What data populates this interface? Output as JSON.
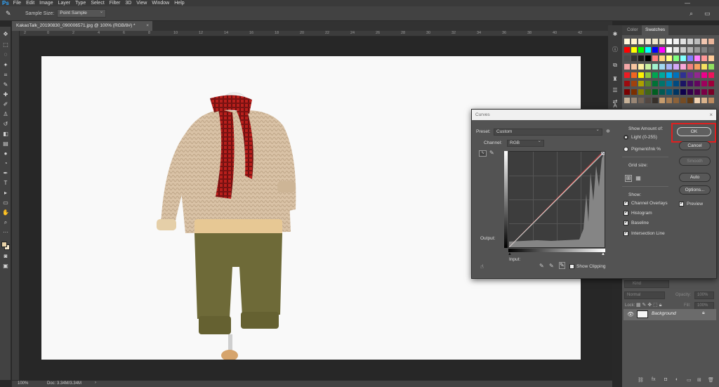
{
  "app": {
    "logo": "Ps"
  },
  "menu": [
    "File",
    "Edit",
    "Image",
    "Layer",
    "Type",
    "Select",
    "Filter",
    "3D",
    "View",
    "Window",
    "Help"
  ],
  "options_bar": {
    "sample_size_label": "Sample Size:",
    "sample_size_value": "Point Sample"
  },
  "document": {
    "tab_title": "KakaoTalk_20190830_090006571.jpg @ 100% (RGB/8#) *",
    "close_glyph": "×"
  },
  "ruler_top_numbers": [
    "2",
    "0",
    "2",
    "4",
    "6",
    "8",
    "10",
    "12",
    "14",
    "16",
    "18",
    "20",
    "22",
    "24",
    "26",
    "28",
    "30",
    "32",
    "34",
    "36",
    "38",
    "40",
    "42"
  ],
  "status": {
    "zoom": "100%",
    "doc": "Doc: 3.34M/3.34M"
  },
  "right_panel": {
    "tabs": [
      "Color",
      "Swatches"
    ],
    "active_tab": "Swatches",
    "layers": {
      "kind_placeholder": "Kind",
      "mode": "Normal",
      "opacity_label": "Opacity:",
      "opacity_value": "100%",
      "lock_label": "Lock:",
      "fill_label": "Fill:",
      "fill_value": "100%",
      "layer_name": "Background"
    }
  },
  "curves": {
    "title": "Curves",
    "preset_label": "Preset:",
    "preset_value": "Custom",
    "channel_label": "Channel:",
    "channel_value": "RGB",
    "output_label": "Output:",
    "input_label": "Input:",
    "show_clipping": "Show Clipping",
    "show_amount_label": "Show Amount of:",
    "light_option": "Light  (0-255)",
    "pigment_option": "Pigment/Ink %",
    "grid_size_label": "Grid size:",
    "show_label": "Show:",
    "channel_overlays": "Channel Overlays",
    "histogram": "Histogram",
    "baseline": "Baseline",
    "intersection_line": "Intersection Line",
    "ok": "OK",
    "cancel": "Cancel",
    "smooth": "Smooth",
    "auto": "Auto",
    "options": "Options...",
    "preview": "Preview",
    "close_glyph": "×"
  },
  "colors": {
    "ok_highlight": "#e02020",
    "ps_blue": "#31a8ff"
  }
}
